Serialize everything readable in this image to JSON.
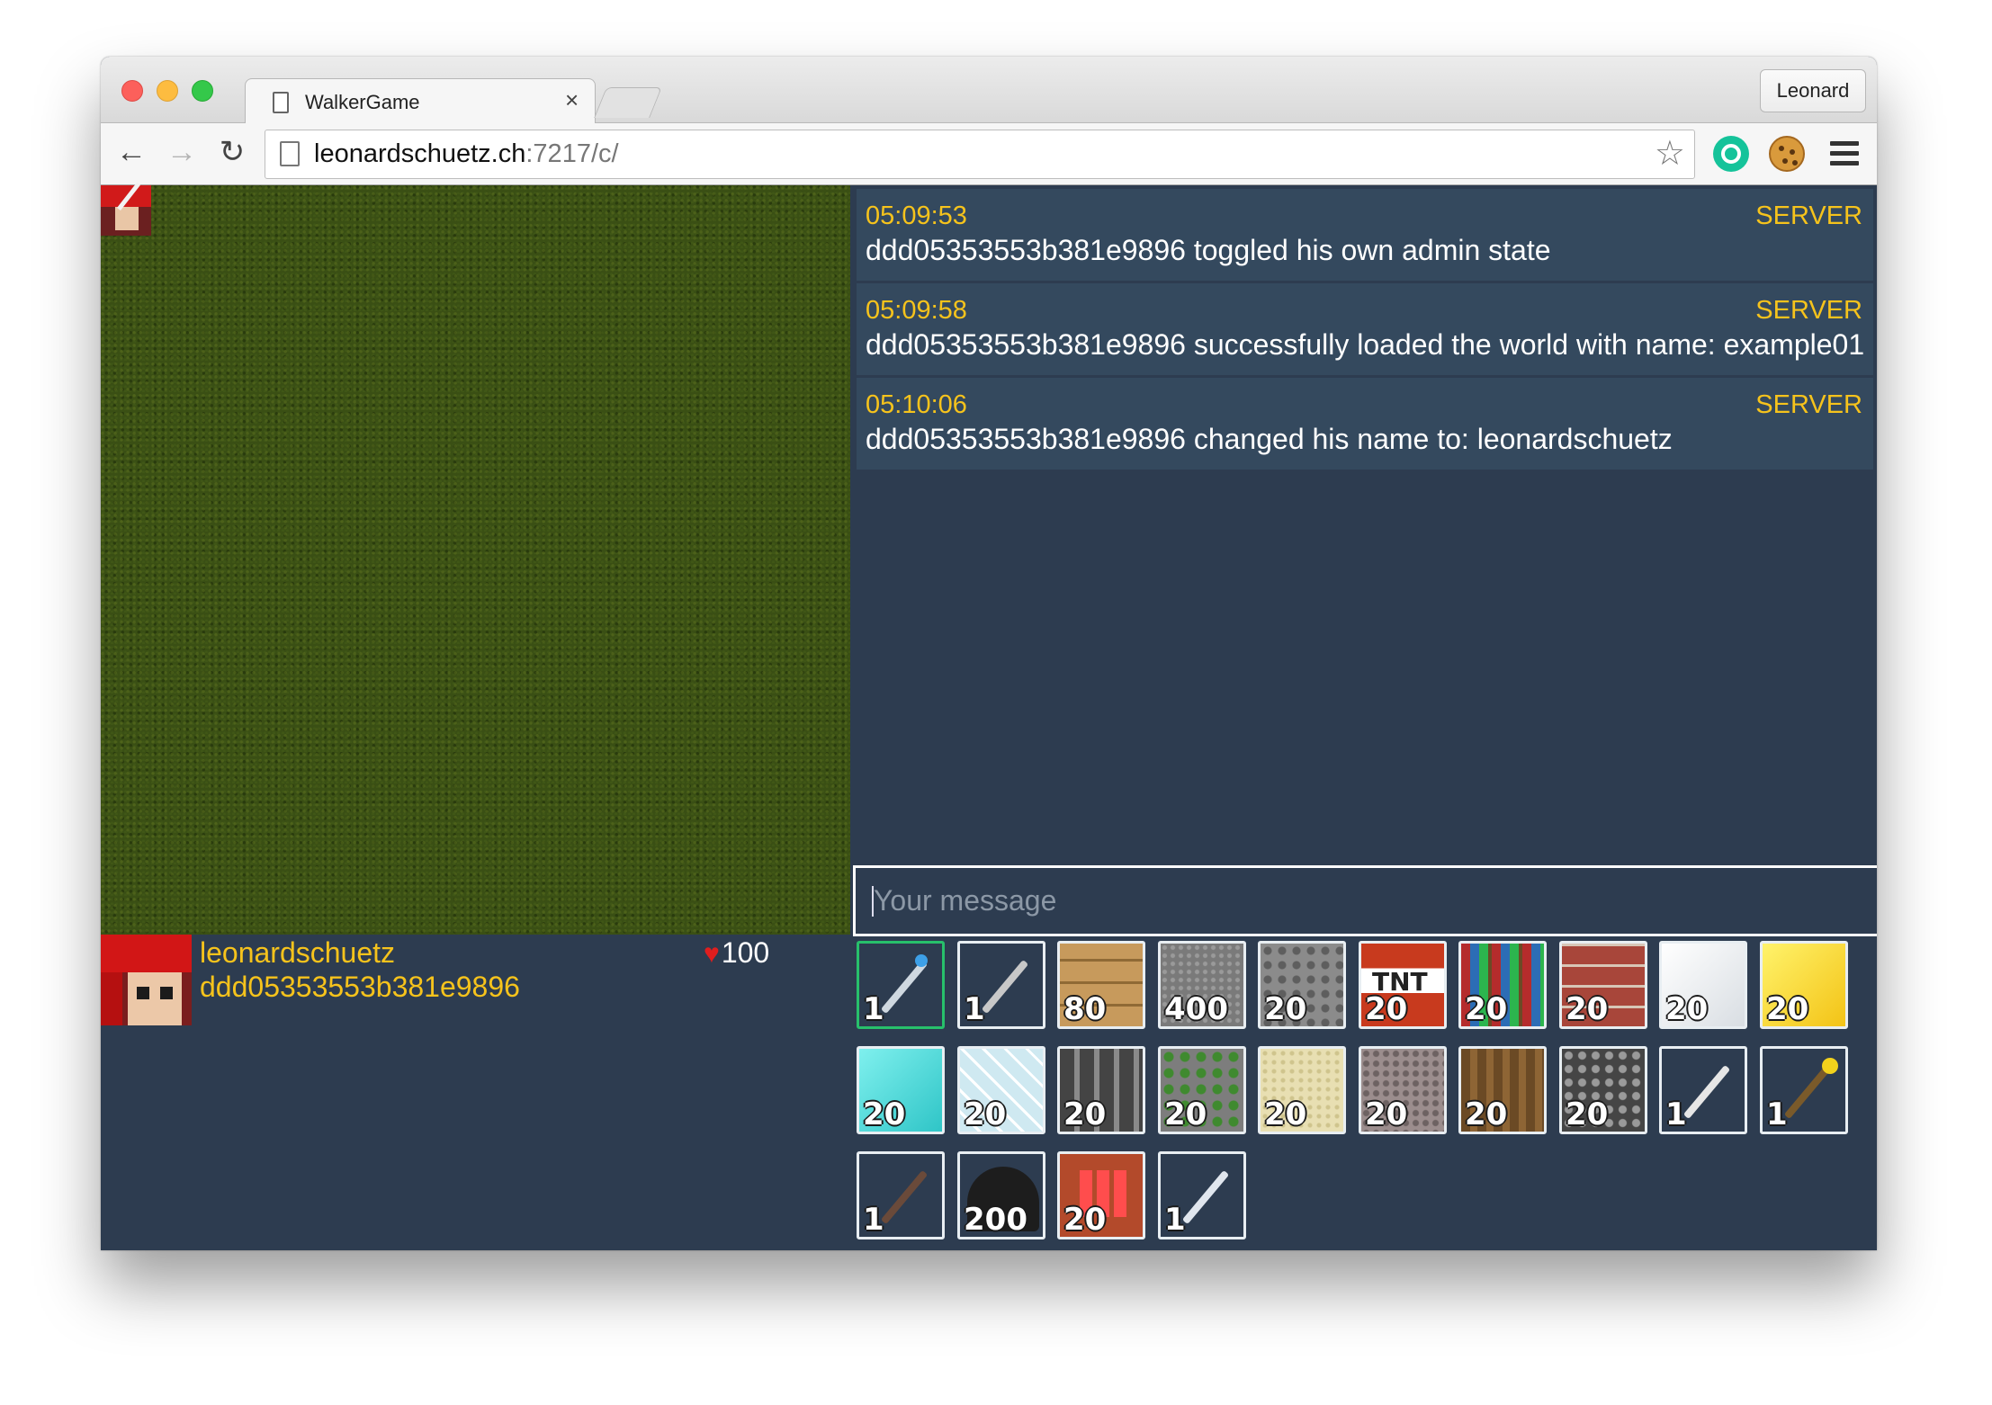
{
  "browser": {
    "tab_title": "WalkerGame",
    "tab_close": "×",
    "profile_name": "Leonard",
    "url_host": "leonardschuetz.ch",
    "url_rest": ":7217/c/"
  },
  "chat": {
    "messages": [
      {
        "time": "05:09:53",
        "sender": "SERVER",
        "text": "ddd05353553b381e9896 toggled his own admin state"
      },
      {
        "time": "05:09:58",
        "sender": "SERVER",
        "text": "ddd05353553b381e9896 successfully loaded the world with name: example01"
      },
      {
        "time": "05:10:06",
        "sender": "SERVER",
        "text": "ddd05353553b381e9896 changed his name to: leonardschuetz"
      }
    ],
    "input_placeholder": "Your message"
  },
  "player": {
    "name": "leonardschuetz",
    "id": "ddd05353553b381e9896",
    "health_icon": "heart-icon",
    "health": "100"
  },
  "inventory": {
    "slots": [
      {
        "item": "pencil",
        "count": "1",
        "selected": true
      },
      {
        "item": "wrench",
        "count": "1"
      },
      {
        "item": "wood-planks",
        "count": "80"
      },
      {
        "item": "gravel",
        "count": "400"
      },
      {
        "item": "cobblestone",
        "count": "20"
      },
      {
        "item": "tnt",
        "count": "20",
        "label": "TNT"
      },
      {
        "item": "bookshelf",
        "count": "20"
      },
      {
        "item": "brick",
        "count": "20"
      },
      {
        "item": "snow",
        "count": "20"
      },
      {
        "item": "gold-block",
        "count": "20"
      },
      {
        "item": "diamond-block",
        "count": "20"
      },
      {
        "item": "glass",
        "count": "20"
      },
      {
        "item": "iron-bars",
        "count": "20"
      },
      {
        "item": "mossy-stone",
        "count": "20"
      },
      {
        "item": "sand",
        "count": "20"
      },
      {
        "item": "granite",
        "count": "20"
      },
      {
        "item": "oak-log",
        "count": "20"
      },
      {
        "item": "bedrock",
        "count": "20"
      },
      {
        "item": "sword",
        "count": "1"
      },
      {
        "item": "gold-wand",
        "count": "1"
      },
      {
        "item": "rifle",
        "count": "1"
      },
      {
        "item": "obsidian-dome",
        "count": "200"
      },
      {
        "item": "crafting-table",
        "count": "20"
      },
      {
        "item": "portal-gun",
        "count": "1"
      }
    ]
  },
  "colors": {
    "background": "#2d3c50",
    "message_bg": "#34495e",
    "accent_yellow": "#f6c31c",
    "selected_slot": "#27c06b",
    "grass": "#3a4f14"
  }
}
